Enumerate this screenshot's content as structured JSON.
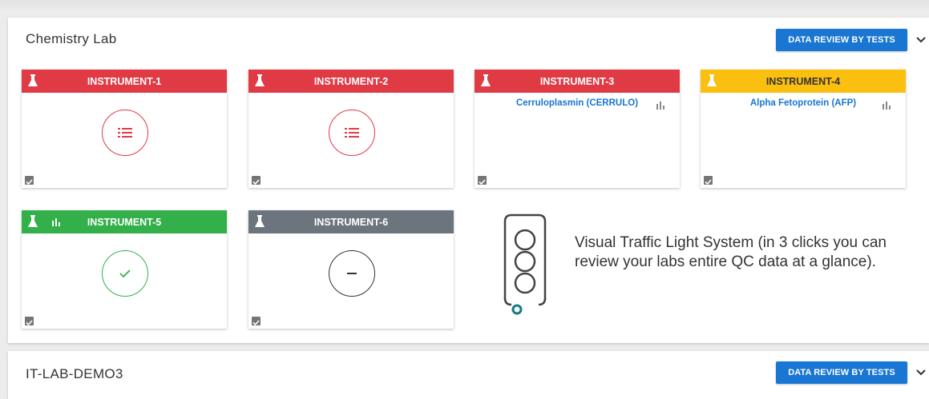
{
  "labs": [
    {
      "name": "Chemistry Lab",
      "button": "DATA REVIEW BY TESTS"
    },
    {
      "name": "IT-LAB-DEMO3",
      "button": "DATA REVIEW BY TESTS"
    }
  ],
  "instruments": [
    {
      "name": "INSTRUMENT-1",
      "status": "red",
      "status_icon": "list-icon",
      "color": "#e03a45"
    },
    {
      "name": "INSTRUMENT-2",
      "status": "red",
      "status_icon": "list-icon",
      "color": "#e03a45"
    },
    {
      "name": "INSTRUMENT-3",
      "status": "red",
      "test": "Cerruloplasmin (CERRULO)",
      "color": "#e03a45"
    },
    {
      "name": "INSTRUMENT-4",
      "status": "yellow",
      "test": "Alpha Fetoprotein (AFP)",
      "color": "#fbbf0f"
    },
    {
      "name": "INSTRUMENT-5",
      "status": "green",
      "status_icon": "check-icon",
      "color": "#33b04a"
    },
    {
      "name": "INSTRUMENT-6",
      "status": "grey",
      "status_icon": "minus-icon",
      "color": "#6c757d"
    }
  ],
  "callout": {
    "text": "Visual Traffic Light System (in 3 clicks you can review your labs entire QC data at a glance)."
  }
}
